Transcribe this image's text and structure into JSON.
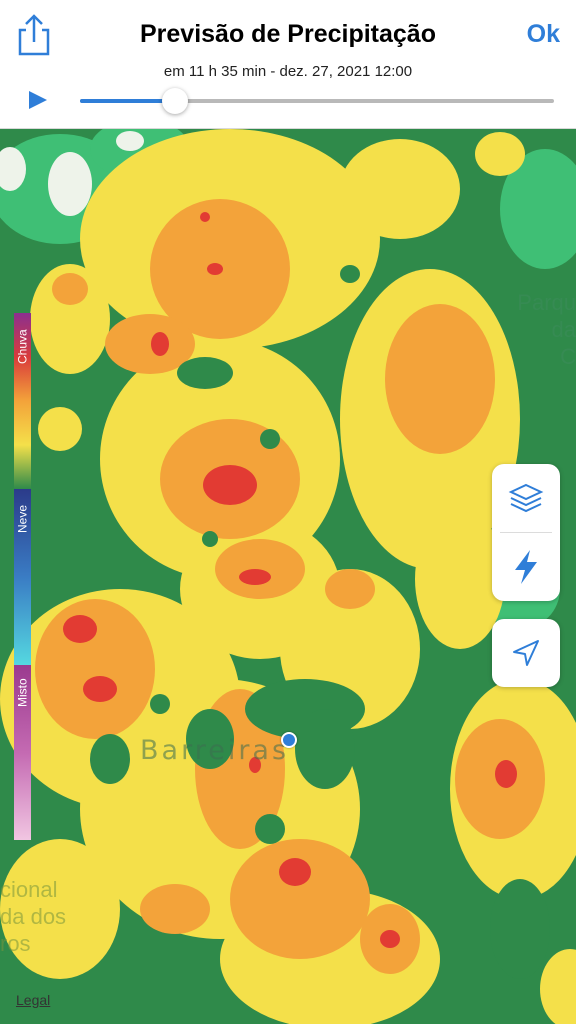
{
  "header": {
    "title": "Previsão de Precipitação",
    "ok_label": "Ok",
    "subtitle": "em 11 h 35 min - dez. 27, 2021 12:00",
    "share_icon": "share-icon",
    "play_icon": "play-icon",
    "slider_progress": 0.2
  },
  "legend": {
    "rain_label": "Chuva",
    "snow_label": "Neve",
    "mixed_label": "Misto"
  },
  "map": {
    "city_label": "Barreiras",
    "park_label": [
      "Parqu",
      "da",
      "C"
    ],
    "reserve_label": [
      "cional",
      "da dos",
      "ros"
    ],
    "legal_label": "Legal"
  },
  "controls": {
    "layers_icon": "layers-icon",
    "lightning_icon": "lightning-icon",
    "location_icon": "location-arrow-icon"
  },
  "colors": {
    "accent": "#2f7ed8",
    "rain_heavy": "#e23b33",
    "rain_moderate": "#f3a33a",
    "rain_light": "#f4e04a",
    "base_green": "#2f8a4a"
  }
}
